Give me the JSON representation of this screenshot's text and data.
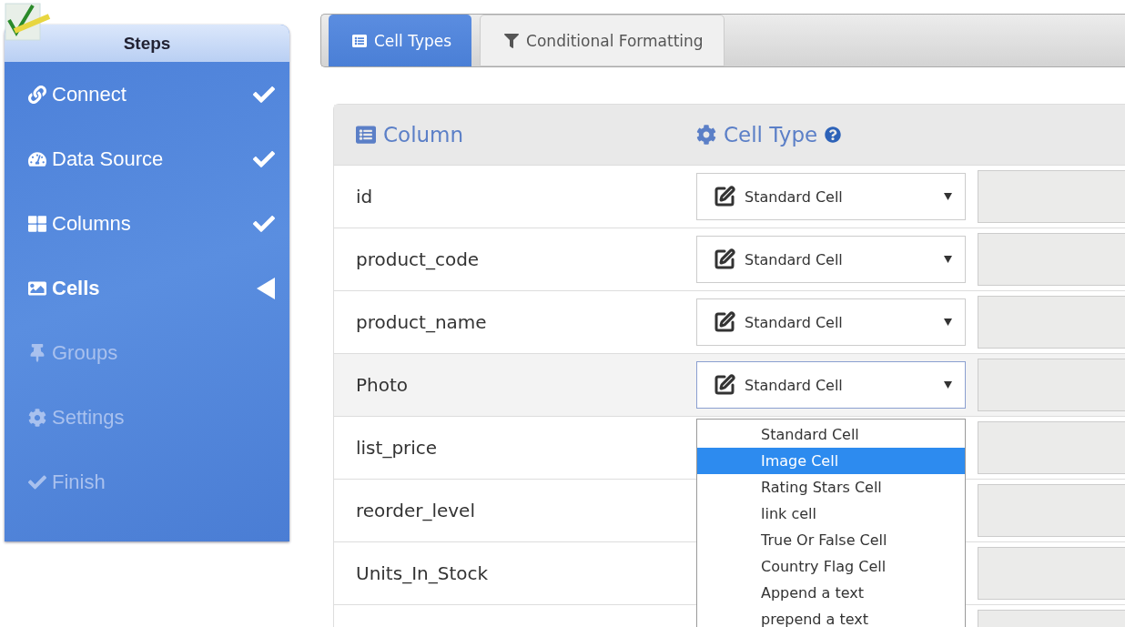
{
  "sidebar": {
    "title": "Steps",
    "items": [
      {
        "label": "Connect",
        "done": true,
        "selected": false,
        "disabled": false
      },
      {
        "label": "Data Source",
        "done": true,
        "selected": false,
        "disabled": false
      },
      {
        "label": "Columns",
        "done": true,
        "selected": false,
        "disabled": false
      },
      {
        "label": "Cells",
        "done": false,
        "selected": true,
        "disabled": false
      },
      {
        "label": "Groups",
        "done": false,
        "selected": false,
        "disabled": true
      },
      {
        "label": "Settings",
        "done": false,
        "selected": false,
        "disabled": true
      },
      {
        "label": "Finish",
        "done": false,
        "selected": false,
        "disabled": true
      }
    ]
  },
  "tabs": [
    {
      "label": "Cell Types",
      "selected": true
    },
    {
      "label": "Conditional Formatting",
      "selected": false
    }
  ],
  "table": {
    "columns": [
      "Column",
      "Cell Type"
    ],
    "rows": [
      {
        "name": "id",
        "cell_type": "Standard Cell",
        "open": false
      },
      {
        "name": "product_code",
        "cell_type": "Standard Cell",
        "open": false
      },
      {
        "name": "product_name",
        "cell_type": "Standard Cell",
        "open": false
      },
      {
        "name": "Photo",
        "cell_type": "Standard Cell",
        "open": true,
        "options": [
          {
            "label": "Standard Cell",
            "selected": false
          },
          {
            "label": "Image Cell",
            "selected": true
          },
          {
            "label": "Rating Stars Cell",
            "selected": false
          },
          {
            "label": "link cell",
            "selected": false
          },
          {
            "label": "True Or False Cell",
            "selected": false
          },
          {
            "label": "Country Flag Cell",
            "selected": false
          },
          {
            "label": "Append a text",
            "selected": false
          },
          {
            "label": "prepend a text",
            "selected": false
          }
        ]
      },
      {
        "name": "list_price",
        "cell_type": null,
        "open": false
      },
      {
        "name": "reorder_level",
        "cell_type": null,
        "open": false
      },
      {
        "name": "Units_In_Stock",
        "cell_type": null,
        "open": false
      }
    ]
  }
}
